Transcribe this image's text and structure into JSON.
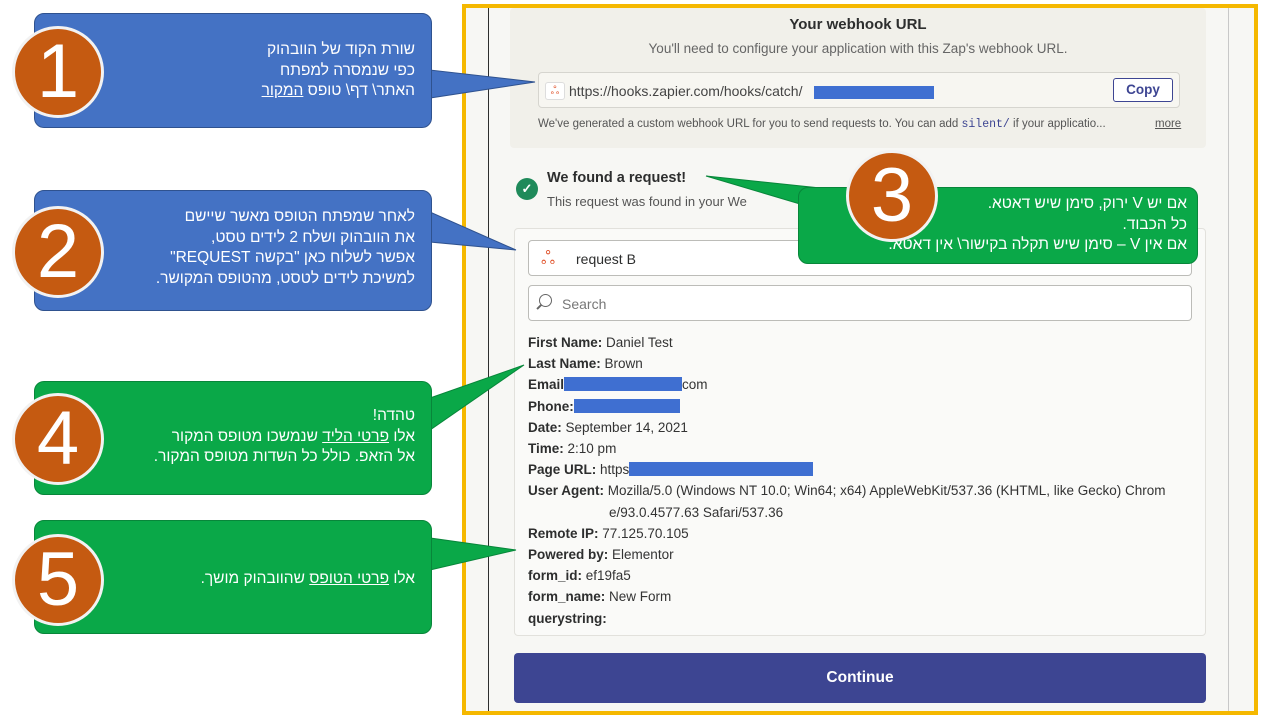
{
  "webhook": {
    "title": "Your webhook URL",
    "subtitle": "You'll need to configure your application with this Zap's webhook URL.",
    "url_prefix": "https://hooks.zapier.com/hooks/catch/",
    "copy_label": "Copy",
    "note_before": "We've generated a custom webhook URL for you to send requests to. You can add ",
    "note_code": "silent/",
    "note_after": " if your applicatio...",
    "more_label": "more"
  },
  "found": {
    "title": "We found a request!",
    "subtitle": "This request was found in your We"
  },
  "request": {
    "selected": "request B",
    "search_placeholder": "Search",
    "fields": [
      {
        "label": "First Name:",
        "value": "Daniel Test"
      },
      {
        "label": "Last Name:",
        "value": "Brown"
      },
      {
        "label": "Email",
        "value": "com"
      },
      {
        "label": "Phone:",
        "value": ""
      },
      {
        "label": "Date:",
        "value": "September 14, 2021"
      },
      {
        "label": "Time:",
        "value": "2:10 pm"
      },
      {
        "label": "Page URL:",
        "value": "https"
      },
      {
        "label": "User Agent:",
        "value": "Mozilla/5.0 (Windows NT 10.0; Win64; x64) AppleWebKit/537.36 (KHTML, like Gecko) Chrom"
      },
      {
        "label": "",
        "value": "e/93.0.4577.63 Safari/537.36"
      },
      {
        "label": "Remote IP:",
        "value": "77.125.70.105"
      },
      {
        "label": "Powered by:",
        "value": "Elementor"
      },
      {
        "label": "form_id:",
        "value": "ef19fa5"
      },
      {
        "label": "form_name:",
        "value": "New Form"
      },
      {
        "label": "querystring:",
        "value": ""
      }
    ],
    "continue_label": "Continue"
  },
  "callouts": {
    "c1": {
      "number": "1",
      "line1": "שורת הקוד של הוובהוק",
      "line2": "כפי שנמסרה למפתח",
      "line3a": "האתר\\ דף\\ טופס ",
      "line3b": "המקור"
    },
    "c2": {
      "number": "2",
      "line1": "לאחר שמפתח הטופס מאשר שיישם",
      "line2": "את הוובהוק ושלח 2 לידים טסט,",
      "line3": "אפשר לשלוח כאן \"בקשה REQUEST\"",
      "line4": "למשיכת לידים לטסט, מהטופס המקושר."
    },
    "c3": {
      "number": "3",
      "line1": "אם יש V ירוק, סימן שיש דאטא.",
      "line2": "כל הכבוד.",
      "line3": "אם אין V – סימן שיש תקלה בקישור\\ אין דאטא."
    },
    "c4": {
      "number": "4",
      "line1": "טהדה!",
      "line2a": "אלו ",
      "line2b": "פרטי הליד",
      "line2c": " שנמשכו מטופס המקור",
      "line3": "אל הזאפ. כולל כל השדות מטופס המקור."
    },
    "c5": {
      "number": "5",
      "line1a": "אלו ",
      "line1b": "פרטי הטופס",
      "line1c": " שהוובהוק מושך."
    }
  },
  "colors": {
    "frame_border": "#f5b800",
    "callout_blue": "#4472c4",
    "callout_green": "#0aa848",
    "number_circle": "#c55a11",
    "zapier_primary": "#3d4592",
    "redaction": "#3f6fd1"
  }
}
